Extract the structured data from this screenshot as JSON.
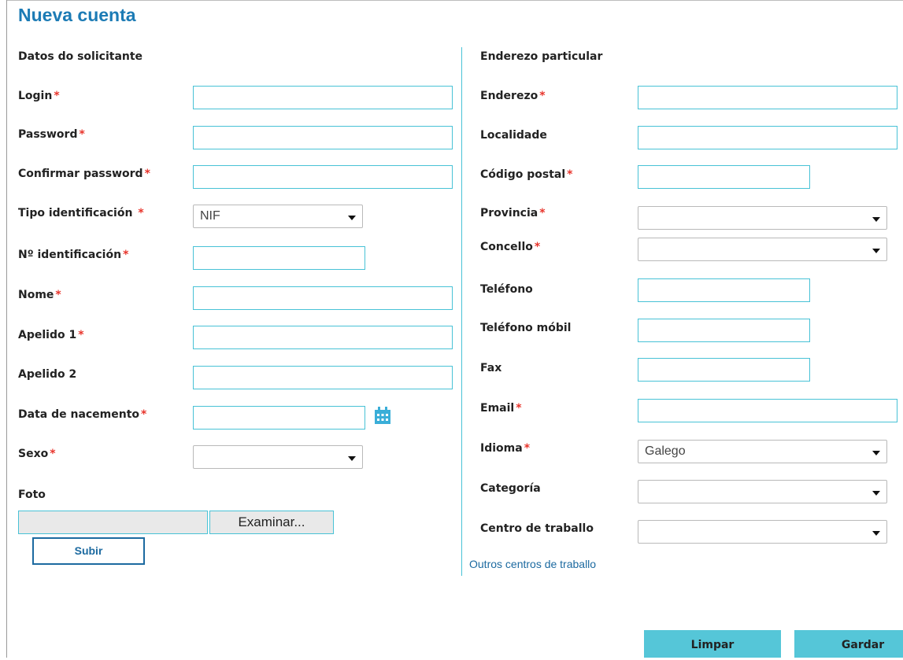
{
  "page": {
    "title": "Nueva cuenta"
  },
  "left": {
    "section_title": "Datos do solicitante",
    "login_label": "Login",
    "password_label": "Password",
    "confirm_password_label": "Confirmar password",
    "id_type_label": "Tipo identificación",
    "id_type_value": "NIF",
    "id_number_label": "Nº identificación",
    "name_label": "Nome",
    "surname1_label": "Apelido 1",
    "surname2_label": "Apelido 2",
    "birthdate_label": "Data de nacemento",
    "sex_label": "Sexo",
    "photo_label": "Foto",
    "browse_label": "Examinar...",
    "upload_label": "Subir"
  },
  "right": {
    "section_title": "Enderezo particular",
    "address_label": "Enderezo",
    "locality_label": "Localidade",
    "postal_code_label": "Código postal",
    "province_label": "Provincia",
    "council_label": "Concello",
    "phone_label": "Teléfono",
    "mobile_label": "Teléfono móbil",
    "fax_label": "Fax",
    "email_label": "Email",
    "language_label": "Idioma",
    "language_value": "Galego",
    "category_label": "Categoría",
    "workplace_label": "Centro de traballo",
    "other_workplaces_link": "Outros centros de traballo"
  },
  "actions": {
    "clear_label": "Limpar",
    "save_label": "Gardar"
  },
  "required_marker": "*",
  "colors": {
    "accent": "#48c2d6",
    "title": "#1c7bb5",
    "required": "#e8342b",
    "button": "#55c6d8"
  },
  "icons": {
    "calendar": "calendar-icon",
    "dropdown": "chevron-down-icon"
  }
}
